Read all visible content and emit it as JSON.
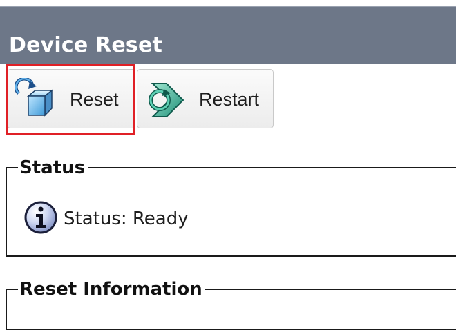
{
  "window": {
    "title": "Device Reset"
  },
  "toolbar": {
    "reset_label": "Reset",
    "restart_label": "Restart",
    "reset_icon": "reset-device-icon",
    "restart_icon": "restart-arrows-icon",
    "focus_color": "#e02026"
  },
  "status_section": {
    "legend": "Status",
    "icon": "info-icon",
    "message": "Status: Ready"
  },
  "reset_info_section": {
    "legend": "Reset Information"
  },
  "colors": {
    "titlebar": "#6d7788",
    "title_text": "#ffffff",
    "accent_red": "#e02026"
  }
}
